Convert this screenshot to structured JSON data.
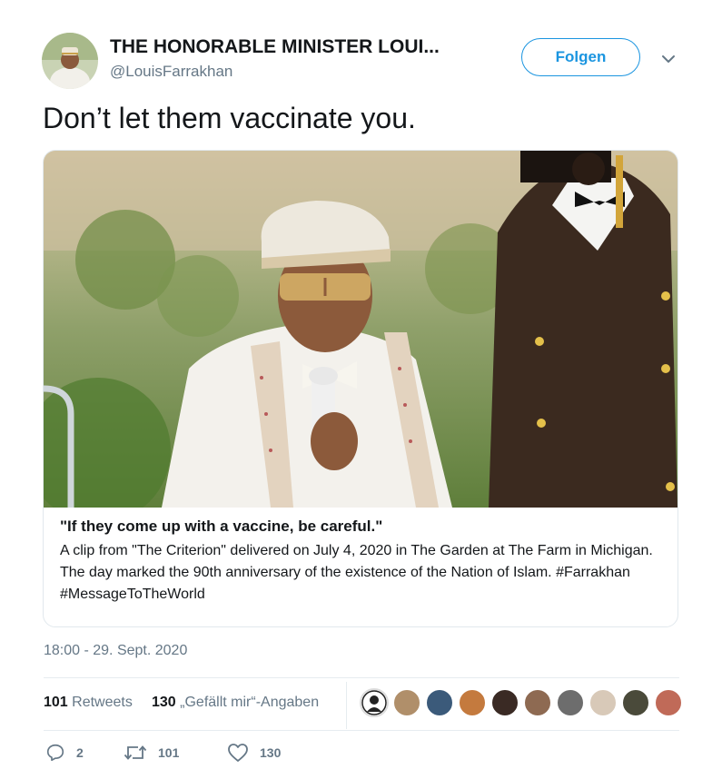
{
  "user": {
    "display_name": "THE HONORABLE MINISTER LOUI...",
    "handle": "@LouisFarrakhan",
    "follow_label": "Folgen"
  },
  "tweet": {
    "text": "Don’t let them vaccinate you.",
    "timestamp": "18:00 - 29. Sept. 2020"
  },
  "card": {
    "title": "\"If they come up with a vaccine, be careful.\"",
    "description": "A clip from \"The Criterion\" delivered on July 4, 2020 in The Garden at The Farm in Michigan. The day marked the 90th anniversary of the existence of the Nation of Islam. #Farrakhan #MessageToTheWorld"
  },
  "stats": {
    "retweets_count": "101",
    "retweets_label": "Retweets",
    "likes_count": "130",
    "likes_label": "„Gefällt mir“-Angaben"
  },
  "actions": {
    "replies": "2",
    "retweets": "101",
    "likes": "130"
  },
  "colors": {
    "accent": "#1b95e0",
    "secondary_text": "#657786",
    "border": "#e1e8ed"
  },
  "icons": [
    "avatar",
    "chevron-down-icon",
    "reply-icon",
    "retweet-icon",
    "heart-icon"
  ]
}
